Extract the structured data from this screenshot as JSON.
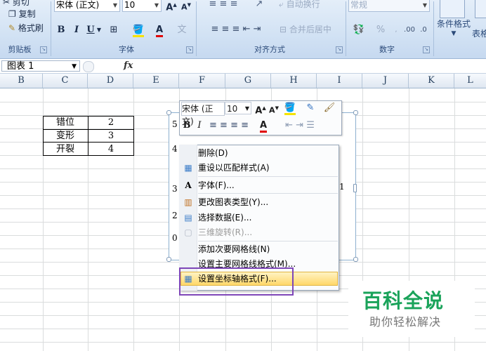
{
  "ribbon": {
    "clipboard": {
      "cut": "剪切",
      "copy": "复制",
      "format_painter": "格式刷",
      "label": "剪贴板"
    },
    "font": {
      "name": "宋体 (正文)",
      "size": "10",
      "bold": "B",
      "italic": "I",
      "underline": "U",
      "label": "字体"
    },
    "alignment": {
      "wrap": "自动换行",
      "merge": "合并后居中",
      "label": "对齐方式"
    },
    "number": {
      "format": "常规",
      "percent": "%",
      "label": "数字"
    },
    "styles": {
      "conditional": "条件格式",
      "table": "表格"
    }
  },
  "formula_bar": {
    "name_box": "图表 1",
    "fx": "fx"
  },
  "columns": [
    "B",
    "C",
    "D",
    "E",
    "F",
    "G",
    "H",
    "I",
    "J",
    "K",
    "L"
  ],
  "table": [
    {
      "label": "错位",
      "value": "2"
    },
    {
      "label": "变形",
      "value": "3"
    },
    {
      "label": "开裂",
      "value": "4"
    }
  ],
  "chart": {
    "axis_top": "5",
    "axis_mid": "4",
    "axis_low": "3",
    "axis_low2": "2",
    "axis_zero": "0",
    "right_val": "1"
  },
  "mini_toolbar": {
    "font": "宋体 (正文)",
    "size": "10",
    "bold": "B",
    "italic": "I",
    "grow": "A",
    "shrink": "A"
  },
  "context_menu": {
    "items": [
      {
        "label": "删除(D)",
        "icon": "",
        "disabled": false
      },
      {
        "label": "重设以匹配样式(A)",
        "icon": "reset-style-icon",
        "disabled": false
      },
      {
        "label": "字体(F)...",
        "icon": "font-icon",
        "disabled": false
      },
      {
        "label": "更改图表类型(Y)...",
        "icon": "chart-type-icon",
        "disabled": false
      },
      {
        "label": "选择数据(E)...",
        "icon": "select-data-icon",
        "disabled": false
      },
      {
        "label": "三维旋转(R)...",
        "icon": "rotate-3d-icon",
        "disabled": true
      },
      {
        "label": "添加次要网格线(N)",
        "icon": "",
        "disabled": false
      },
      {
        "label": "设置主要网格线格式(M)...",
        "icon": "",
        "disabled": false
      },
      {
        "label": "设置坐标轴格式(F)...",
        "icon": "format-axis-icon",
        "disabled": false,
        "highlighted": true
      }
    ]
  },
  "watermark": {
    "title": "百科全说",
    "subtitle": "助你轻松解决"
  },
  "colors": {
    "highlight_outline": "#7e46b8",
    "watermark_green": "#1aa35a"
  }
}
